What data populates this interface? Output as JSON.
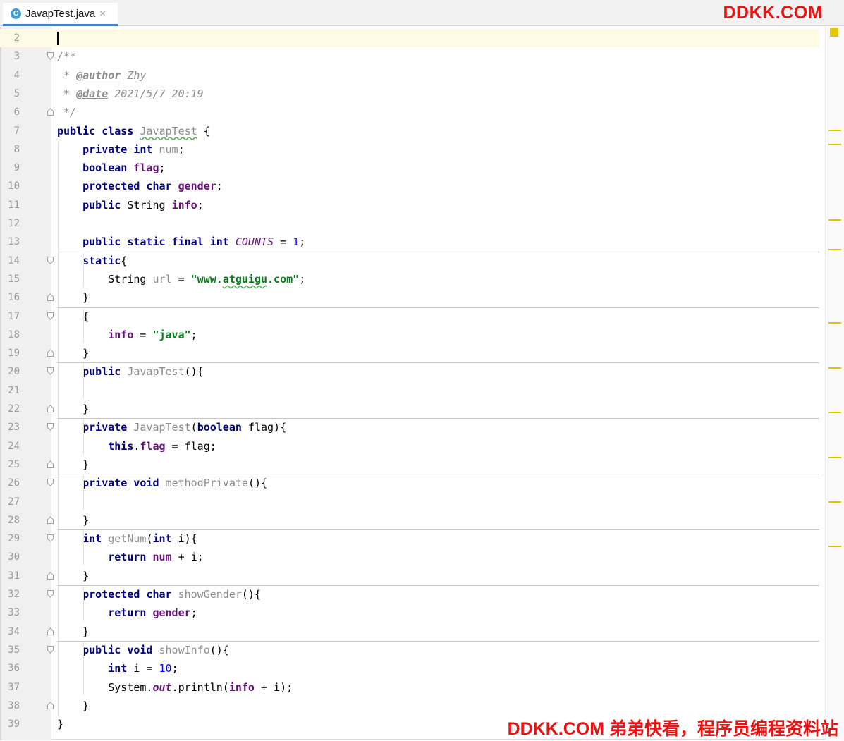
{
  "tab": {
    "icon_letter": "C",
    "title": "JavapTest.java",
    "close": "×",
    "icon": "java-class-icon"
  },
  "brand": "DDKK.COM",
  "footer_brand": "DDKK.COM 弟弟快看，程序员编程资料站",
  "colors": {
    "keyword": "#000080",
    "field": "#660e7a",
    "string": "#067d17",
    "number": "#0000ff",
    "comment": "#8c8c8c",
    "current_line": "#fffae3",
    "tab_underline": "#4083c9",
    "brand": "#ee1111",
    "marker": "#e0c000"
  },
  "lines": [
    {
      "n": "2",
      "t": []
    },
    {
      "n": "3",
      "t": [
        [
          "cmt",
          "/**"
        ]
      ]
    },
    {
      "n": "4",
      "t": [
        [
          "cmt",
          " * "
        ],
        [
          "tag",
          "@author"
        ],
        [
          "cmt",
          " Zhy"
        ]
      ]
    },
    {
      "n": "5",
      "t": [
        [
          "cmt",
          " * "
        ],
        [
          "tag",
          "@date"
        ],
        [
          "cmt",
          " 2021/5/7 20:19"
        ]
      ]
    },
    {
      "n": "6",
      "t": [
        [
          "cmt",
          " */"
        ]
      ]
    },
    {
      "n": "7",
      "t": [
        [
          "kw",
          "public class "
        ],
        [
          "unused wavy",
          "JavapTest"
        ],
        [
          "",
          " {"
        ]
      ]
    },
    {
      "n": "8",
      "t": [
        [
          "",
          "    "
        ],
        [
          "kw",
          "private int "
        ],
        [
          "unused",
          "num"
        ],
        [
          "",
          ";"
        ]
      ]
    },
    {
      "n": "9",
      "t": [
        [
          "",
          "    "
        ],
        [
          "kw",
          "boolean "
        ],
        [
          "fld",
          "flag"
        ],
        [
          "",
          ";"
        ]
      ]
    },
    {
      "n": "10",
      "t": [
        [
          "",
          "    "
        ],
        [
          "kw",
          "protected char "
        ],
        [
          "fld",
          "gender"
        ],
        [
          "",
          ";"
        ]
      ]
    },
    {
      "n": "11",
      "t": [
        [
          "",
          "    "
        ],
        [
          "kw",
          "public "
        ],
        [
          "",
          "String "
        ],
        [
          "fld",
          "info"
        ],
        [
          "",
          ";"
        ]
      ]
    },
    {
      "n": "12",
      "t": []
    },
    {
      "n": "13",
      "t": [
        [
          "",
          "    "
        ],
        [
          "kw",
          "public static final int "
        ],
        [
          "constI",
          "COUNTS"
        ],
        [
          "",
          " = "
        ],
        [
          "num",
          "1"
        ],
        [
          "",
          ";"
        ]
      ]
    },
    {
      "n": "14",
      "t": [
        [
          "",
          "    "
        ],
        [
          "kw",
          "static"
        ],
        [
          "",
          "{"
        ]
      ]
    },
    {
      "n": "15",
      "t": [
        [
          "",
          "        String "
        ],
        [
          "unused",
          "url"
        ],
        [
          "",
          " = "
        ],
        [
          "str",
          "\"www."
        ],
        [
          "str wavy",
          "atguigu"
        ],
        [
          "str",
          ".com\""
        ],
        [
          "",
          ";"
        ]
      ]
    },
    {
      "n": "16",
      "t": [
        [
          "",
          "    }"
        ]
      ]
    },
    {
      "n": "17",
      "t": [
        [
          "",
          "    {"
        ]
      ]
    },
    {
      "n": "18",
      "t": [
        [
          "",
          "        "
        ],
        [
          "fld",
          "info"
        ],
        [
          "",
          " = "
        ],
        [
          "str",
          "\"java\""
        ],
        [
          "",
          ";"
        ]
      ]
    },
    {
      "n": "19",
      "t": [
        [
          "",
          "    }"
        ]
      ]
    },
    {
      "n": "20",
      "t": [
        [
          "",
          "    "
        ],
        [
          "kw",
          "public "
        ],
        [
          "unused",
          "JavapTest"
        ],
        [
          "",
          "(){"
        ]
      ]
    },
    {
      "n": "21",
      "t": []
    },
    {
      "n": "22",
      "t": [
        [
          "",
          "    }"
        ]
      ]
    },
    {
      "n": "23",
      "t": [
        [
          "",
          "    "
        ],
        [
          "kw",
          "private "
        ],
        [
          "unused",
          "JavapTest"
        ],
        [
          "",
          "("
        ],
        [
          "kw",
          "boolean "
        ],
        [
          "",
          "flag){"
        ]
      ]
    },
    {
      "n": "24",
      "t": [
        [
          "",
          "        "
        ],
        [
          "kw",
          "this"
        ],
        [
          "",
          "."
        ],
        [
          "fld",
          "flag"
        ],
        [
          "",
          " = flag;"
        ]
      ]
    },
    {
      "n": "25",
      "t": [
        [
          "",
          "    }"
        ]
      ]
    },
    {
      "n": "26",
      "t": [
        [
          "",
          "    "
        ],
        [
          "kw",
          "private void "
        ],
        [
          "unused",
          "methodPrivate"
        ],
        [
          "",
          "(){"
        ]
      ]
    },
    {
      "n": "27",
      "t": []
    },
    {
      "n": "28",
      "t": [
        [
          "",
          "    }"
        ]
      ]
    },
    {
      "n": "29",
      "t": [
        [
          "",
          "    "
        ],
        [
          "kw",
          "int "
        ],
        [
          "unused",
          "getNum"
        ],
        [
          "",
          "("
        ],
        [
          "kw",
          "int "
        ],
        [
          "",
          "i){"
        ]
      ]
    },
    {
      "n": "30",
      "t": [
        [
          "",
          "        "
        ],
        [
          "kw",
          "return "
        ],
        [
          "fld",
          "num"
        ],
        [
          "",
          " + i;"
        ]
      ]
    },
    {
      "n": "31",
      "t": [
        [
          "",
          "    }"
        ]
      ]
    },
    {
      "n": "32",
      "t": [
        [
          "",
          "    "
        ],
        [
          "kw",
          "protected char "
        ],
        [
          "unused",
          "showGender"
        ],
        [
          "",
          "(){"
        ]
      ]
    },
    {
      "n": "33",
      "t": [
        [
          "",
          "        "
        ],
        [
          "kw",
          "return "
        ],
        [
          "fld",
          "gender"
        ],
        [
          "",
          ";"
        ]
      ]
    },
    {
      "n": "34",
      "t": [
        [
          "",
          "    }"
        ]
      ]
    },
    {
      "n": "35",
      "t": [
        [
          "",
          "    "
        ],
        [
          "kw",
          "public void "
        ],
        [
          "unused",
          "showInfo"
        ],
        [
          "",
          "(){"
        ]
      ]
    },
    {
      "n": "36",
      "t": [
        [
          "",
          "        "
        ],
        [
          "kw",
          "int "
        ],
        [
          "",
          "i = "
        ],
        [
          "num",
          "10"
        ],
        [
          "",
          ";"
        ]
      ]
    },
    {
      "n": "37",
      "t": [
        [
          "",
          "        System."
        ],
        [
          "fldi",
          "out"
        ],
        [
          "",
          ".println("
        ],
        [
          "fld",
          "info"
        ],
        [
          "",
          " + i);"
        ]
      ]
    },
    {
      "n": "38",
      "t": [
        [
          "",
          "    }"
        ]
      ]
    },
    {
      "n": "39",
      "t": [
        [
          "",
          "}"
        ]
      ]
    }
  ]
}
